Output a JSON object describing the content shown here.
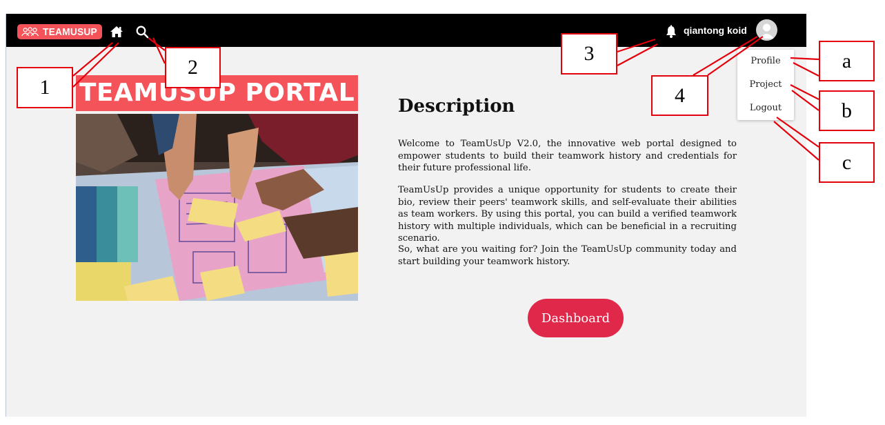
{
  "navbar": {
    "logo_text": "TEAMUSUP",
    "username": "qiantong koid",
    "icons": [
      "home-icon",
      "search-icon",
      "bell-icon",
      "avatar-icon"
    ]
  },
  "user_menu": {
    "items": [
      {
        "label": "Profile"
      },
      {
        "label": "Project"
      },
      {
        "label": "Logout"
      }
    ]
  },
  "main": {
    "banner_text": "TEAMUSUP PORTAL",
    "description_title": "Description",
    "paragraphs": [
      "Welcome to TeamUsUp V2.0, the innovative web portal designed to empower students to build their teamwork history and credentials for their future professional life.",
      "TeamUsUp provides a unique opportunity for students to create their bio, review their peers' teamwork skills, and self-evaluate their abilities as team workers. By using this portal, you can build a verified teamwork history with multiple individuals, which can be beneficial in a recruiting scenario.",
      "So, what are you waiting for? Join the TeamUsUp community today and start building your teamwork history."
    ],
    "dashboard_label": "Dashboard"
  },
  "callouts": {
    "c1": "1",
    "c2": "2",
    "c3": "3",
    "c4": "4",
    "ca": "a",
    "cb": "b",
    "cc": "c"
  },
  "colors": {
    "navbar": "#000000",
    "brand": "#f4535a",
    "button": "#e0284a",
    "callout_border": "#e3000b",
    "page_bg": "#f2f2f2"
  }
}
